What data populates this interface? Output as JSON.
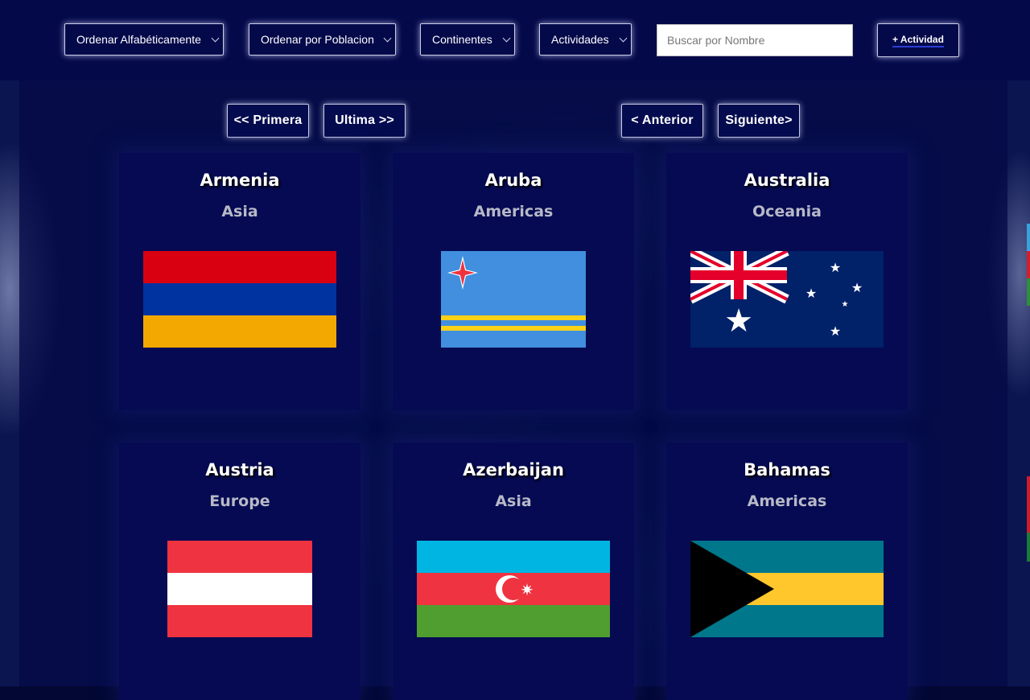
{
  "toolbar": {
    "sort_alpha": "Ordenar Alfabéticamente",
    "sort_population": "Ordenar por Poblacion",
    "continents": "Continentes",
    "activities": "Actividades",
    "search_placeholder": "Buscar por Nombre",
    "add_activity": "+ Actividad"
  },
  "pagination": {
    "first": "<< Primera",
    "last": "Ultima >>",
    "prev": "< Anterior",
    "next": "Siguiente>"
  },
  "countries": [
    {
      "name": "Armenia",
      "continent": "Asia",
      "flag": "armenia-flag"
    },
    {
      "name": "Aruba",
      "continent": "Americas",
      "flag": "aruba-flag"
    },
    {
      "name": "Australia",
      "continent": "Oceania",
      "flag": "australia-flag"
    },
    {
      "name": "Austria",
      "continent": "Europe",
      "flag": "austria-flag"
    },
    {
      "name": "Azerbaijan",
      "continent": "Asia",
      "flag": "azerbaijan-flag"
    },
    {
      "name": "Bahamas",
      "continent": "Americas",
      "flag": "bahamas-flag"
    }
  ],
  "colors": {
    "background": "#020733",
    "card": "#050a52",
    "accent_underline": "#2a3fd0"
  }
}
